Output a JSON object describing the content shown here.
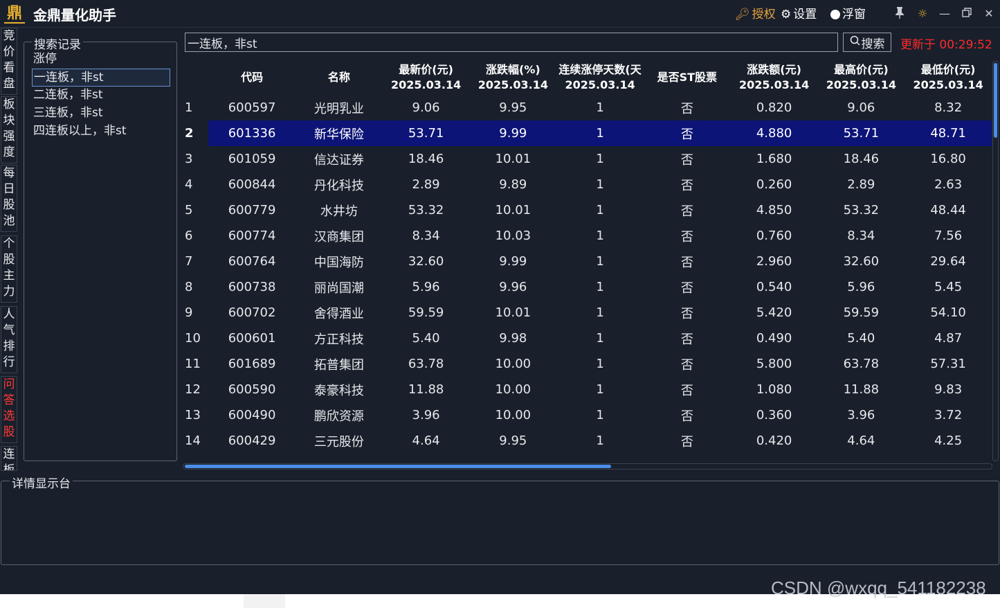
{
  "titlebar": {
    "logo_text": "鼎",
    "title": "金鼎量化助手",
    "auth_label": "授权",
    "settings_label": "设置",
    "float_label": "浮窗"
  },
  "vtabs": [
    "竞价看盘",
    "板块强度",
    "每日股池",
    "个股主力",
    "人气排行",
    "问答选股",
    "连板"
  ],
  "record_panel": {
    "legend": "搜索记录",
    "items": [
      "涨停",
      "一连板，非st",
      "二连板，非st",
      "三连板，非st",
      "四连板以上，非st"
    ],
    "selected_index": 1
  },
  "search": {
    "value": "一连板，非st",
    "button_label": "搜索",
    "update_text": "更新于 00:29:52"
  },
  "table": {
    "headers": [
      {
        "l1": "",
        "l2": ""
      },
      {
        "l1": "代码",
        "l2": ""
      },
      {
        "l1": "名称",
        "l2": ""
      },
      {
        "l1": "最新价(元)",
        "l2": "2025.03.14"
      },
      {
        "l1": "涨跌幅(%)",
        "l2": "2025.03.14"
      },
      {
        "l1": "连续涨停天数(天",
        "l2": "2025.03.14"
      },
      {
        "l1": "是否ST股票",
        "l2": ""
      },
      {
        "l1": "涨跌额(元)",
        "l2": "2025.03.14"
      },
      {
        "l1": "最高价(元)",
        "l2": "2025.03.14"
      },
      {
        "l1": "最低价(元)",
        "l2": "2025.03.14"
      }
    ],
    "selected_row": 1,
    "rows": [
      [
        "1",
        "600597",
        "光明乳业",
        "9.06",
        "9.95",
        "1",
        "否",
        "0.820",
        "9.06",
        "8.32"
      ],
      [
        "2",
        "601336",
        "新华保险",
        "53.71",
        "9.99",
        "1",
        "否",
        "4.880",
        "53.71",
        "48.71"
      ],
      [
        "3",
        "601059",
        "信达证券",
        "18.46",
        "10.01",
        "1",
        "否",
        "1.680",
        "18.46",
        "16.80"
      ],
      [
        "4",
        "600844",
        "丹化科技",
        "2.89",
        "9.89",
        "1",
        "否",
        "0.260",
        "2.89",
        "2.63"
      ],
      [
        "5",
        "600779",
        "水井坊",
        "53.32",
        "10.01",
        "1",
        "否",
        "4.850",
        "53.32",
        "48.44"
      ],
      [
        "6",
        "600774",
        "汉商集团",
        "8.34",
        "10.03",
        "1",
        "否",
        "0.760",
        "8.34",
        "7.56"
      ],
      [
        "7",
        "600764",
        "中国海防",
        "32.60",
        "9.99",
        "1",
        "否",
        "2.960",
        "32.60",
        "29.64"
      ],
      [
        "8",
        "600738",
        "丽尚国潮",
        "5.96",
        "9.96",
        "1",
        "否",
        "0.540",
        "5.96",
        "5.45"
      ],
      [
        "9",
        "600702",
        "舍得酒业",
        "59.59",
        "10.01",
        "1",
        "否",
        "5.420",
        "59.59",
        "54.10"
      ],
      [
        "10",
        "600601",
        "方正科技",
        "5.40",
        "9.98",
        "1",
        "否",
        "0.490",
        "5.40",
        "4.87"
      ],
      [
        "11",
        "601689",
        "拓普集团",
        "63.78",
        "10.00",
        "1",
        "否",
        "5.800",
        "63.78",
        "57.31"
      ],
      [
        "12",
        "600590",
        "泰豪科技",
        "11.88",
        "10.00",
        "1",
        "否",
        "1.080",
        "11.88",
        "9.83"
      ],
      [
        "13",
        "600490",
        "鹏欣资源",
        "3.96",
        "10.00",
        "1",
        "否",
        "0.360",
        "3.96",
        "3.72"
      ],
      [
        "14",
        "600429",
        "三元股份",
        "4.64",
        "9.95",
        "1",
        "否",
        "0.420",
        "4.64",
        "4.25"
      ]
    ]
  },
  "detail_panel": {
    "legend": "详情显示台"
  },
  "watermark": "CSDN @wxqq_541182238",
  "colors": {
    "background": "#19202b",
    "selected_row": "#0c1478",
    "update_text": "#ff2a2a",
    "active_tab": "#ff3a3a",
    "auth": "#e8a040",
    "scroll_thumb": "#4a8ee8"
  }
}
